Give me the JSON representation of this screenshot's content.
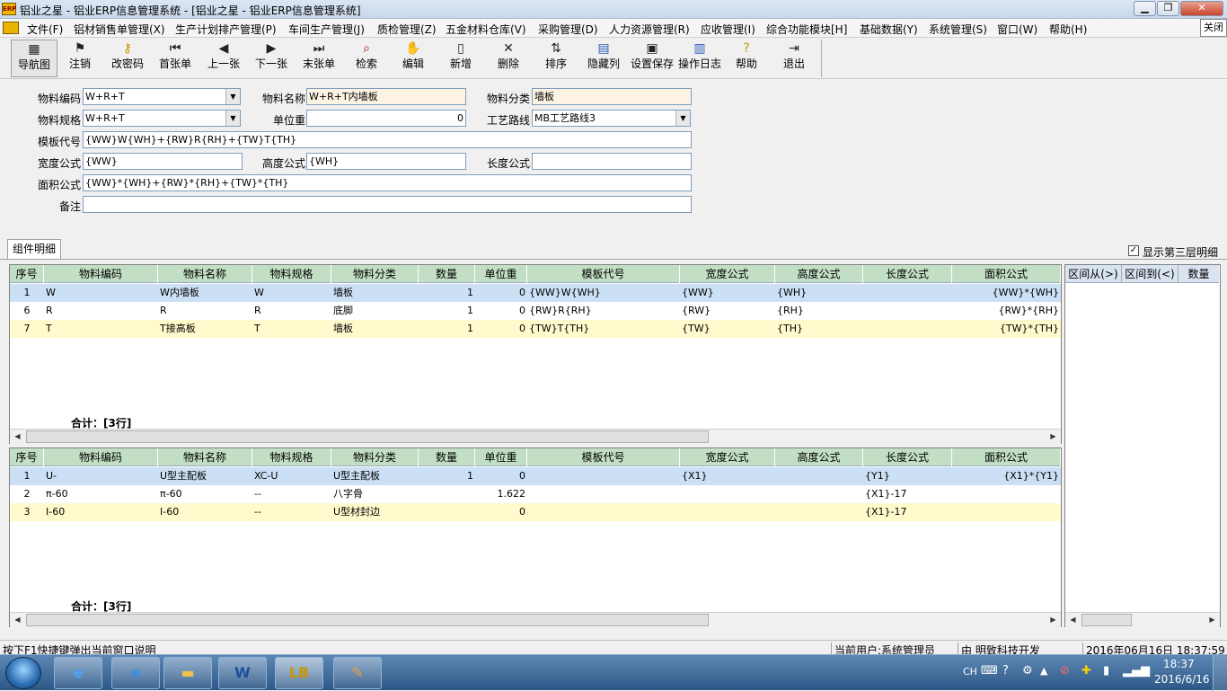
{
  "window": {
    "title": "铝业之星 - 铝业ERP信息管理系统 - [铝业之星 - 铝业ERP信息管理系统]",
    "icon_text": "ERP",
    "close_tooltip": "关闭",
    "controls": [
      "minimize-icon",
      "restore-icon",
      "close-icon"
    ]
  },
  "menu": {
    "items": [
      "文件(F)",
      "铝材销售单管理(X)",
      "生产计划排产管理(P)",
      "车间生产管理(J)",
      "质检管理(Z)",
      "五金材料仓库(V)",
      "采购管理(D)",
      "人力资源管理(R)",
      "应收管理(I)",
      "综合功能模块[H]",
      "基础数据(Y)",
      "系统管理(S)",
      "窗口(W)",
      "帮助(H)"
    ]
  },
  "toolbar": {
    "buttons": [
      {
        "label": "导航图",
        "icon": "map-icon"
      },
      {
        "label": "注销",
        "icon": "logout-icon"
      },
      {
        "label": "改密码",
        "icon": "key-icon"
      },
      {
        "label": "首张单",
        "icon": "first-icon"
      },
      {
        "label": "上一张",
        "icon": "prev-icon"
      },
      {
        "label": "下一张",
        "icon": "next-icon"
      },
      {
        "label": "末张单",
        "icon": "last-icon"
      },
      {
        "label": "检索",
        "icon": "search-icon"
      },
      {
        "label": "编辑",
        "icon": "edit-icon"
      },
      {
        "label": "新增",
        "icon": "new-icon"
      },
      {
        "label": "删除",
        "icon": "delete-icon"
      },
      {
        "label": "排序",
        "icon": "sort-icon"
      },
      {
        "label": "隐藏列",
        "icon": "hide-columns-icon"
      },
      {
        "label": "设置保存",
        "icon": "save-icon"
      },
      {
        "label": "操作日志",
        "icon": "log-icon"
      },
      {
        "label": "帮助",
        "icon": "help-icon"
      },
      {
        "label": "退出",
        "icon": "exit-icon"
      }
    ]
  },
  "form": {
    "material_code_label": "物料编码",
    "material_code": "W+R+T",
    "material_name_label": "物料名称",
    "material_name": "W+R+T内墙板",
    "material_category_label": "物料分类",
    "material_category": "墙板",
    "material_spec_label": "物料规格",
    "material_spec": "W+R+T",
    "unit_weight_label": "单位重",
    "unit_weight": "0",
    "process_route_label": "工艺路线",
    "process_route": "MB工艺路线3",
    "template_code_label": "模板代号",
    "template_code": "{WW}W{WH}+{RW}R{RH}+{TW}T{TH}",
    "width_formula_label": "宽度公式",
    "width_formula": "{WW}",
    "height_formula_label": "高度公式",
    "height_formula": "{WH}",
    "length_formula_label": "长度公式",
    "length_formula": "",
    "area_formula_label": "面积公式",
    "area_formula": "{WW}*{WH}+{RW}*{RH}+{TW}*{TH}",
    "remark_label": "备注",
    "remark": ""
  },
  "tabs": {
    "component_detail": "组件明细",
    "show_third_level": "显示第三层明细",
    "show_third_level_checked": true
  },
  "grid_columns": [
    "序号",
    "物料编码",
    "物料名称",
    "物料规格",
    "物料分类",
    "数量",
    "单位重",
    "模板代号",
    "宽度公式",
    "高度公式",
    "长度公式",
    "面积公式"
  ],
  "grid1": {
    "rows": [
      [
        "1",
        "W",
        "W内墙板",
        "W",
        "墙板",
        "1",
        "0",
        "{WW}W{WH}",
        "{WW}",
        "{WH}",
        "",
        "{WW}*{WH}"
      ],
      [
        "6",
        "R",
        "R",
        "R",
        "底脚",
        "1",
        "0",
        "{RW}R{RH}",
        "{RW}",
        "{RH}",
        "",
        "{RW}*{RH}"
      ],
      [
        "7",
        "T",
        "T接高板",
        "T",
        "墙板",
        "1",
        "0",
        "{TW}T{TH}",
        "{TW}",
        "{TH}",
        "",
        "{TW}*{TH}"
      ]
    ],
    "total": "合计：[3行]"
  },
  "grid2": {
    "rows": [
      [
        "1",
        "U-",
        "U型主配板",
        "XC-U",
        "U型主配板",
        "1",
        "0",
        "",
        "{X1}",
        "",
        "{Y1}",
        "{X1}*{Y1}"
      ],
      [
        "2",
        "π-60",
        "π-60",
        "--",
        "八字骨",
        "",
        "1.622",
        "",
        "",
        "",
        "{X1}-17",
        ""
      ],
      [
        "3",
        "I-60",
        "I-60",
        "--",
        "U型材封边",
        "",
        "0",
        "",
        "",
        "",
        "{X1}-17",
        ""
      ]
    ],
    "total": "合计：[3行]"
  },
  "side_grid": {
    "columns": [
      "区间从(>)",
      "区间到(<)",
      "数量"
    ]
  },
  "status": {
    "hint": "按下F1快捷键弹出当前窗口说明",
    "user": "当前用户:系统管理员",
    "company": "由 明致科技开发",
    "datetime": "2016年06月16日 18:37:59"
  },
  "taskbar": {
    "time": "18:37",
    "date": "2016/6/16",
    "lang": "CH"
  },
  "colors": {
    "grid_header": "#c2dfc5",
    "row_selected": "#cce0f5",
    "row_alt": "#fffacc",
    "readonly_field": "#fdf3e3"
  }
}
